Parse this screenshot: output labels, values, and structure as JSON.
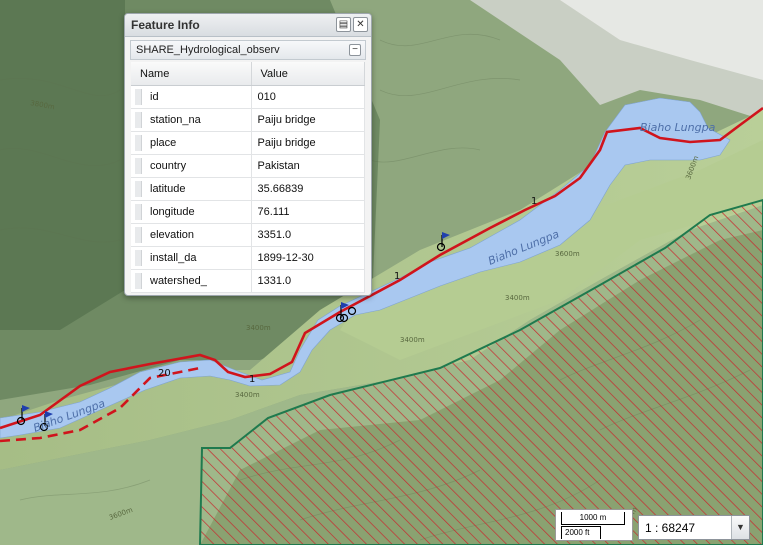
{
  "feature_info": {
    "title": "Feature Info",
    "pin_icon": "pin-icon",
    "close_icon": "close-icon",
    "layer_name": "SHARE_Hydrological_observ",
    "collapse_icon": "minus-icon",
    "columns": [
      "Name",
      "Value"
    ],
    "rows": [
      {
        "name": "id",
        "value": "010"
      },
      {
        "name": "station_na",
        "value": "Paiju bridge"
      },
      {
        "name": "place",
        "value": "Paiju bridge"
      },
      {
        "name": "country",
        "value": "Pakistan"
      },
      {
        "name": "latitude",
        "value": "35.66839"
      },
      {
        "name": "longitude",
        "value": "76.111"
      },
      {
        "name": "elevation",
        "value": "3351.0"
      },
      {
        "name": "install_da",
        "value": "1899-12-30"
      },
      {
        "name": "watershed_",
        "value": "1331.0"
      }
    ]
  },
  "map": {
    "river_labels": [
      "Biaho Lungpa",
      "Biaho Lungpa",
      "Biaho Lungpa"
    ],
    "route_numbers": [
      "1",
      "1",
      "1",
      "20"
    ],
    "contour_labels": [
      "3800m",
      "3600m",
      "3400m",
      "3400m",
      "3400m",
      "3600m",
      "3400m",
      "4000m",
      "3600m",
      "3800m"
    ],
    "colors": {
      "river": "#a9c8f0",
      "route": "#d0141c",
      "boundary": "#1f7a4e",
      "hatch": "#c8292e"
    }
  },
  "scale": {
    "top": "1000 m",
    "bottom": "2000 ft"
  },
  "zoom": {
    "value": "1 : 68247",
    "arrow_icon": "chevron-down-icon"
  }
}
